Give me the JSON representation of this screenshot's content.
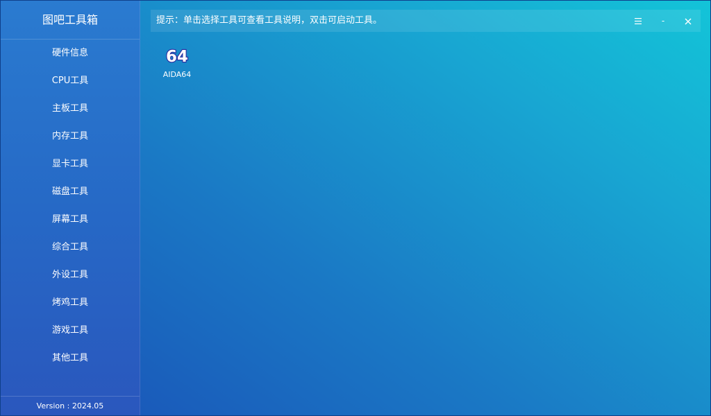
{
  "app": {
    "title": "图吧工具箱",
    "version": "Version : 2024.05"
  },
  "sidebar": {
    "items": [
      {
        "label": "硬件信息"
      },
      {
        "label": "CPU工具"
      },
      {
        "label": "主板工具"
      },
      {
        "label": "内存工具"
      },
      {
        "label": "显卡工具"
      },
      {
        "label": "磁盘工具"
      },
      {
        "label": "屏幕工具"
      },
      {
        "label": "综合工具"
      },
      {
        "label": "外设工具"
      },
      {
        "label": "烤鸡工具"
      },
      {
        "label": "游戏工具"
      },
      {
        "label": "其他工具"
      }
    ]
  },
  "topbar": {
    "hint": "提示：单击选择工具可查看工具说明，双击可启动工具。",
    "menu_icon": "hamburger-menu-icon",
    "minimize_label": "-",
    "close_icon": "close-icon"
  },
  "tools": [
    {
      "label": "AIDA64",
      "icon_text": "64",
      "icon": "aida64-icon"
    }
  ],
  "colors": {
    "sidebar_top": "#2a7bd0",
    "sidebar_bottom": "#2a57bd",
    "main_gradient_start": "#1a4fb6",
    "main_gradient_end": "#13c4d8",
    "text": "#ffffff",
    "icon_outline": "#2a2aa0"
  }
}
